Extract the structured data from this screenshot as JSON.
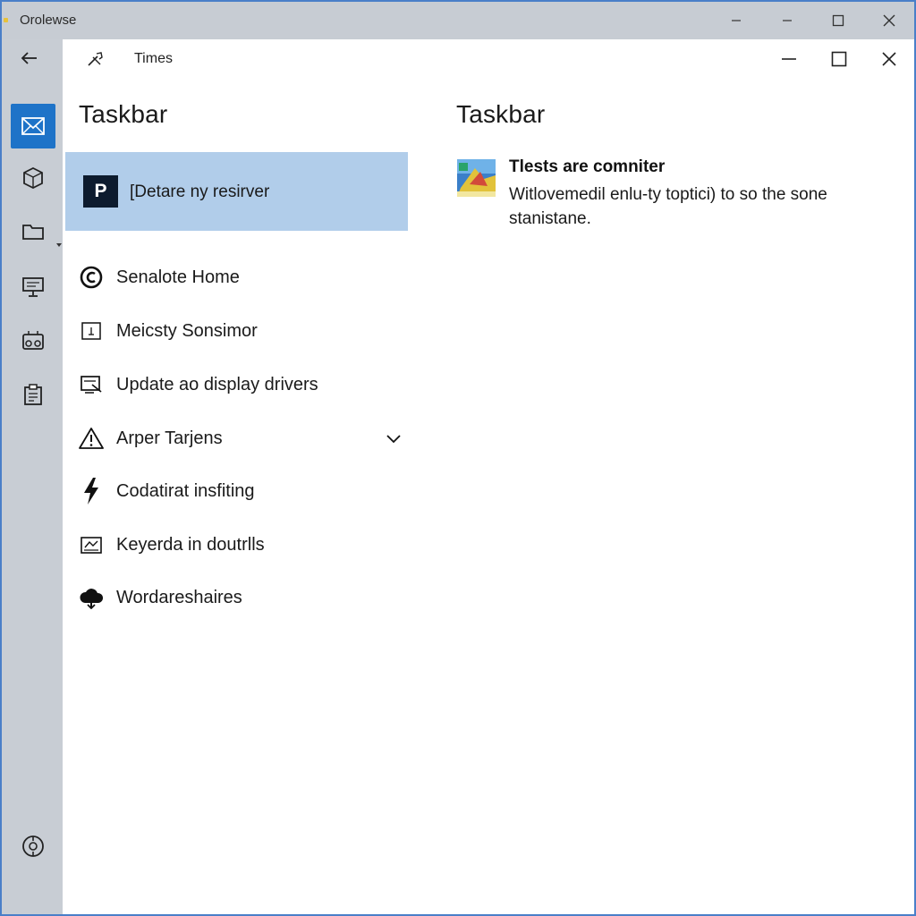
{
  "window": {
    "outer_title": "Orolewse",
    "inner_title": "Times"
  },
  "left_pane": {
    "heading": "Taskbar",
    "selected_item": {
      "badge": "P",
      "label": "[Detare ny resirver"
    },
    "items": [
      {
        "label": "Senalote Home",
        "icon": "circle-c-icon"
      },
      {
        "label": "Meicsty Sonsimor",
        "icon": "small-box-icon"
      },
      {
        "label": "Update ao display drivers",
        "icon": "display-driver-icon"
      },
      {
        "label": "Arper Tarjens",
        "icon": "warning-icon",
        "expandable": true
      },
      {
        "label": "Codatirat insfiting",
        "icon": "lightning-icon"
      },
      {
        "label": "Keyerda in doutrlls",
        "icon": "keyboard-icon"
      },
      {
        "label": "Wordareshaires",
        "icon": "cloud-share-icon"
      }
    ]
  },
  "right_pane": {
    "heading": "Taskbar",
    "article": {
      "title": "Tlests are comniter",
      "body": "Witlovemedil enlu-ty toptici) to so the sone stanistane."
    }
  },
  "colors": {
    "rail_bg": "#c8cdd4",
    "accent": "#1e73c8",
    "selected_bg": "#b1cdea",
    "badge_bg": "#0d1b2e"
  }
}
